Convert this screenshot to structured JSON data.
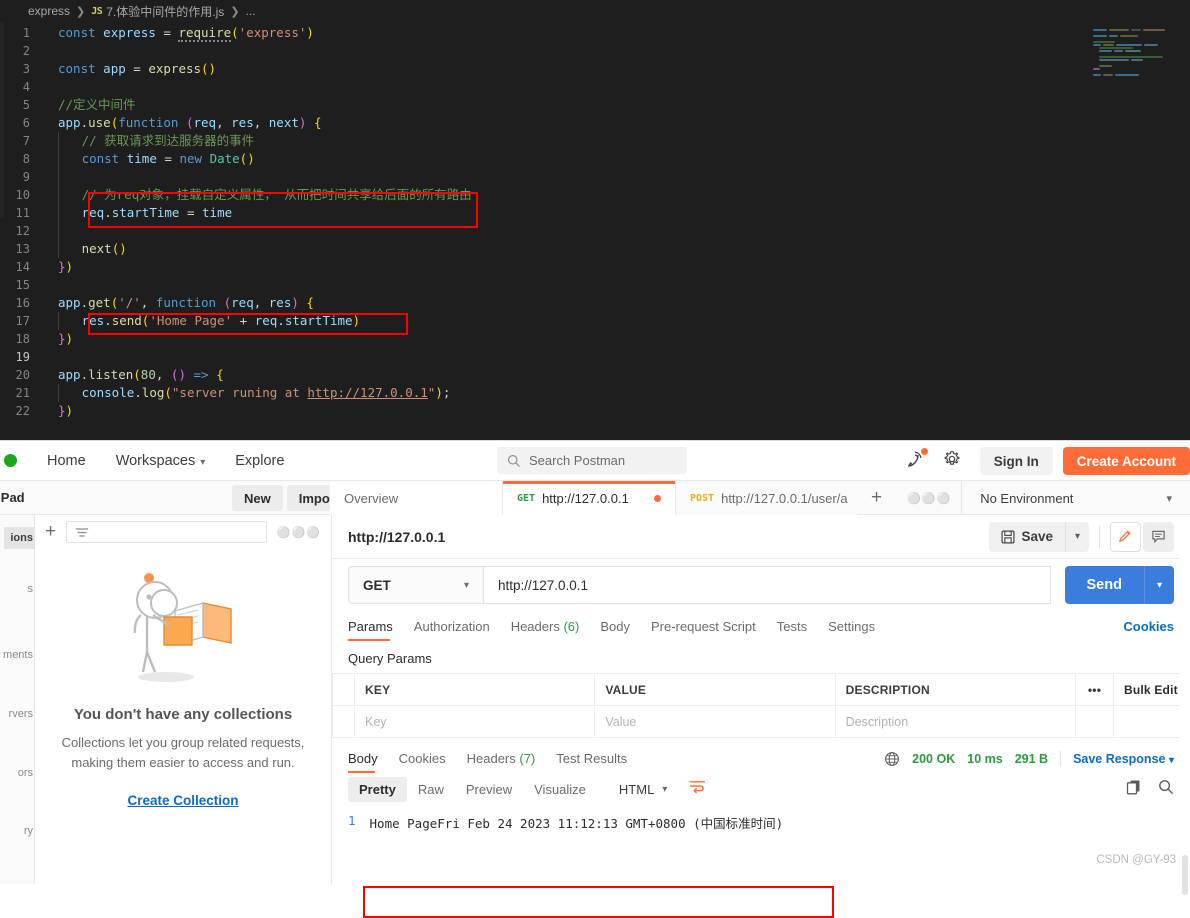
{
  "editor": {
    "breadcrumb": {
      "root": "express",
      "file": "7.体验中间件的作用.js",
      "badge": "JS",
      "more": "..."
    },
    "lines": [
      {
        "n": "1",
        "type": "code"
      },
      {
        "n": "2",
        "type": "code"
      },
      {
        "n": "3",
        "type": "code"
      },
      {
        "n": "4",
        "type": "code"
      },
      {
        "n": "5",
        "type": "code"
      },
      {
        "n": "6",
        "type": "code"
      },
      {
        "n": "7",
        "type": "code"
      },
      {
        "n": "8",
        "type": "code"
      },
      {
        "n": "9",
        "type": "code"
      },
      {
        "n": "10",
        "type": "code"
      },
      {
        "n": "11",
        "type": "code"
      },
      {
        "n": "12",
        "type": "code"
      },
      {
        "n": "13",
        "type": "code"
      },
      {
        "n": "14",
        "type": "code"
      },
      {
        "n": "15",
        "type": "code"
      },
      {
        "n": "16",
        "type": "code"
      },
      {
        "n": "17",
        "type": "code"
      },
      {
        "n": "18",
        "type": "code"
      },
      {
        "n": "19",
        "type": "code"
      },
      {
        "n": "20",
        "type": "code"
      },
      {
        "n": "21",
        "type": "code"
      },
      {
        "n": "22",
        "type": "code"
      }
    ],
    "source": {
      "l1": "const express = require('express')",
      "l3": "const app = express()",
      "l5": "//定义中间件",
      "l6": "app.use(function (req, res, next) {",
      "l7": "// 获取请求到达服务器的事件",
      "l8": "const time = new Date()",
      "l10": "// 为req对象，挂载自定义属性， 从而把时间共享给后面的所有路由",
      "l11": "req.startTime = time",
      "l13": "next()",
      "l14": "})",
      "l16": "app.get('/', function (req, res) {",
      "l17": "res.send('Home Page' + req.startTime)",
      "l18": "})",
      "l20": "app.listen(80, () => {",
      "l21": "console.log(\"server runing at http://127.0.0.1\");",
      "l22": "})"
    },
    "highlight_boxes": [
      "comment-and-startTime-assignment",
      "res-send-home-page"
    ]
  },
  "postman": {
    "nav": {
      "home": "Home",
      "workspaces": "Workspaces",
      "explore": "Explore",
      "search_placeholder": "Search Postman",
      "sign_in": "Sign In",
      "create_account": "Create Account"
    },
    "workbench": {
      "scratch_pad": "ch Pad",
      "new": "New",
      "import": "Import",
      "environment": "No Environment"
    },
    "tabs": [
      {
        "label": "Overview",
        "method": "",
        "dirty": false,
        "active": false
      },
      {
        "label": "http://127.0.0.1",
        "method": "GET",
        "dirty": true,
        "active": true
      },
      {
        "label": "http://127.0.0.1/user/a",
        "method": "POST",
        "dirty": true,
        "active": false
      }
    ],
    "sidebar_rail": [
      {
        "label": "ions",
        "full": "Collections",
        "selected": true
      },
      {
        "label": "s",
        "full": "APIs",
        "selected": false
      },
      {
        "label": "ments",
        "full": "Environments",
        "selected": false
      },
      {
        "label": "rvers",
        "full": "Mock Servers",
        "selected": false
      },
      {
        "label": "ors",
        "full": "Monitors",
        "selected": false
      },
      {
        "label": "ry",
        "full": "History",
        "selected": false
      }
    ],
    "collections": {
      "filter_placeholder": "",
      "empty_title": "You don't have any collections",
      "empty_desc": "Collections let you group related requests, making them easier to access and run.",
      "create_link": "Create Collection"
    },
    "request": {
      "title": "http://127.0.0.1",
      "save_label": "Save",
      "method": "GET",
      "url": "http://127.0.0.1",
      "send_label": "Send",
      "tabs": [
        {
          "label": "Params",
          "count": "",
          "active": true
        },
        {
          "label": "Authorization",
          "count": "",
          "active": false
        },
        {
          "label": "Headers",
          "count": "(6)",
          "active": false
        },
        {
          "label": "Body",
          "count": "",
          "active": false
        },
        {
          "label": "Pre-request Script",
          "count": "",
          "active": false
        },
        {
          "label": "Tests",
          "count": "",
          "active": false
        },
        {
          "label": "Settings",
          "count": "",
          "active": false
        }
      ],
      "cookies_link": "Cookies",
      "query_params_label": "Query Params",
      "table": {
        "headers": [
          "KEY",
          "VALUE",
          "DESCRIPTION"
        ],
        "dots": "•••",
        "bulk_edit": "Bulk Edit",
        "row_placeholders": [
          "Key",
          "Value",
          "Description"
        ]
      }
    },
    "response": {
      "tabs": [
        {
          "label": "Body",
          "count": "",
          "active": true
        },
        {
          "label": "Cookies",
          "count": "",
          "active": false
        },
        {
          "label": "Headers",
          "count": "(7)",
          "active": false
        },
        {
          "label": "Test Results",
          "count": "",
          "active": false
        }
      ],
      "status": "200 OK",
      "time": "10 ms",
      "size": "291 B",
      "save_response": "Save Response",
      "formats": [
        {
          "label": "Pretty",
          "active": true
        },
        {
          "label": "Raw",
          "active": false
        },
        {
          "label": "Preview",
          "active": false
        },
        {
          "label": "Visualize",
          "active": false
        }
      ],
      "format_type": "HTML",
      "line_number": "1",
      "body_text": "Home PageFri Feb 24 2023 11:12:13 GMT+0800 (中国标准时间)"
    },
    "watermark": "CSDN @GY-93",
    "colors": {
      "accent": "#ff6c37",
      "send": "#3b7ddd",
      "success": "#2a9b3e",
      "link": "#0b6bcb",
      "annotation": "#ff0000"
    }
  }
}
